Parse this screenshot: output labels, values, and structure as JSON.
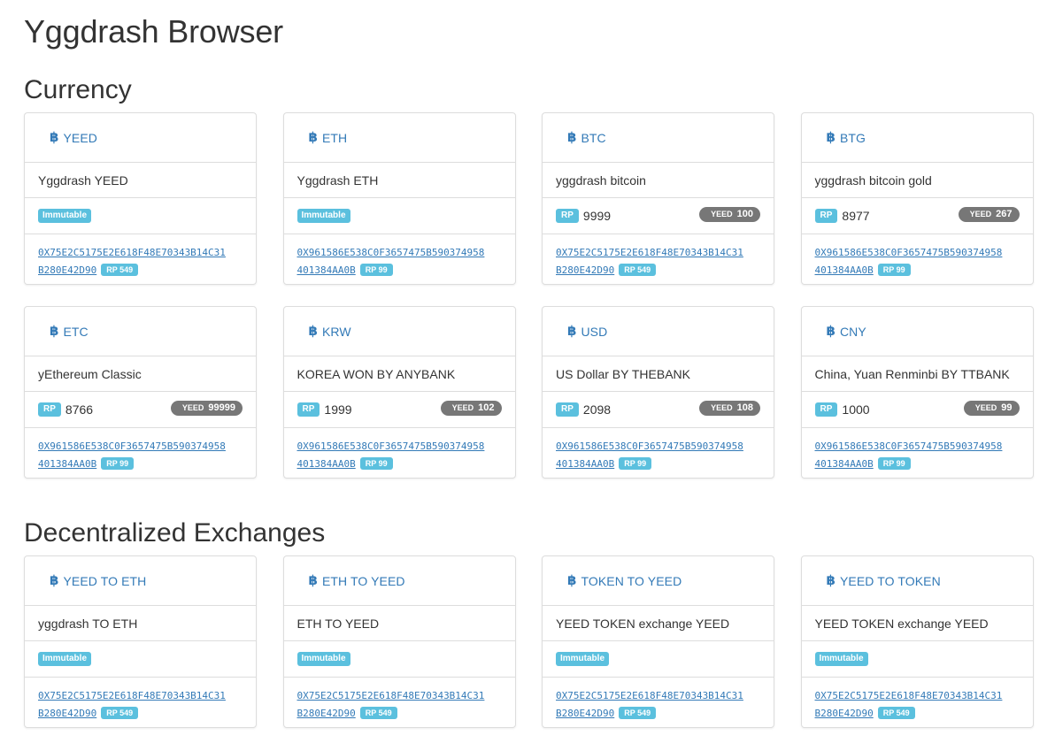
{
  "app": {
    "title": "Yggdrash Browser"
  },
  "colors": {
    "link": "#337ab7",
    "info_label": "#5bc0de",
    "badge": "#777777",
    "border": "#dddddd"
  },
  "currency": {
    "title": "Currency",
    "cards": [
      {
        "icon": "bitcoin-icon",
        "symbol": "YEED",
        "description": "Yggdrash YEED",
        "label": "Immutable",
        "address_line1": "0X75E2C5175E2E618F48E70343B14C31",
        "address_line2": "B280E42D90",
        "address_rp": "RP 549"
      },
      {
        "icon": "bitcoin-icon",
        "symbol": "ETH",
        "description": "Yggdrash ETH",
        "label": "Immutable",
        "address_line1": "0X961586E538C0F3657475B590374958",
        "address_line2": "401384AA0B",
        "address_rp": "RP 99"
      },
      {
        "icon": "bitcoin-icon",
        "symbol": "BTC",
        "description": "yggdrash bitcoin",
        "rp_label": "RP",
        "rp_value": "9999",
        "badge_label": "YEED",
        "badge_value": "100",
        "address_line1": "0X75E2C5175E2E618F48E70343B14C31",
        "address_line2": "B280E42D90",
        "address_rp": "RP 549"
      },
      {
        "icon": "bitcoin-icon",
        "symbol": "BTG",
        "description": "yggdrash bitcoin gold",
        "rp_label": "RP",
        "rp_value": "8977",
        "badge_label": "YEED",
        "badge_value": "267",
        "address_line1": "0X961586E538C0F3657475B590374958",
        "address_line2": "401384AA0B",
        "address_rp": "RP 99"
      },
      {
        "icon": "bitcoin-icon",
        "symbol": "ETC",
        "description": "yEthereum Classic",
        "rp_label": "RP",
        "rp_value": "8766",
        "badge_label": "YEED",
        "badge_value": "99999",
        "address_line1": "0X961586E538C0F3657475B590374958",
        "address_line2": "401384AA0B",
        "address_rp": "RP 99"
      },
      {
        "icon": "bitcoin-icon",
        "symbol": "KRW",
        "description": "KOREA WON BY ANYBANK",
        "rp_label": "RP",
        "rp_value": "1999",
        "badge_label": "YEED",
        "badge_value": "102",
        "address_line1": "0X961586E538C0F3657475B590374958",
        "address_line2": "401384AA0B",
        "address_rp": "RP 99"
      },
      {
        "icon": "bitcoin-icon",
        "symbol": "USD",
        "description": "US Dollar BY THEBANK",
        "rp_label": "RP",
        "rp_value": "2098",
        "badge_label": "YEED",
        "badge_value": "108",
        "address_line1": "0X961586E538C0F3657475B590374958",
        "address_line2": "401384AA0B",
        "address_rp": "RP 99"
      },
      {
        "icon": "bitcoin-icon",
        "symbol": "CNY",
        "description": "China, Yuan Renminbi BY TTBANK",
        "rp_label": "RP",
        "rp_value": "1000",
        "badge_label": "YEED",
        "badge_value": "99",
        "address_line1": "0X961586E538C0F3657475B590374958",
        "address_line2": "401384AA0B",
        "address_rp": "RP 99"
      }
    ]
  },
  "exchanges": {
    "title": "Decentralized Exchanges",
    "cards": [
      {
        "icon": "bitcoin-icon",
        "symbol": "YEED TO ETH",
        "description": "yggdrash TO ETH",
        "label": "Immutable",
        "address_line1": "0X75E2C5175E2E618F48E70343B14C31",
        "address_line2": "B280E42D90",
        "address_rp": "RP 549"
      },
      {
        "icon": "bitcoin-icon",
        "symbol": "ETH TO YEED",
        "description": "ETH TO YEED",
        "label": "Immutable",
        "address_line1": "0X75E2C5175E2E618F48E70343B14C31",
        "address_line2": "B280E42D90",
        "address_rp": "RP 549"
      },
      {
        "icon": "bitcoin-icon",
        "symbol": "TOKEN TO YEED",
        "description": "YEED TOKEN exchange YEED",
        "label": "Immutable",
        "address_line1": "0X75E2C5175E2E618F48E70343B14C31",
        "address_line2": "B280E42D90",
        "address_rp": "RP 549"
      },
      {
        "icon": "bitcoin-icon",
        "symbol": "YEED TO TOKEN",
        "description": "YEED TOKEN exchange YEED",
        "label": "Immutable",
        "address_line1": "0X75E2C5175E2E618F48E70343B14C31",
        "address_line2": "B280E42D90",
        "address_rp": "RP 549"
      }
    ]
  }
}
